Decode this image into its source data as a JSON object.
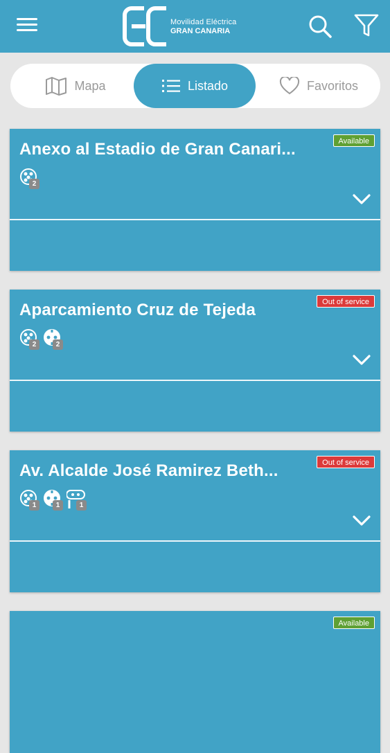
{
  "header": {
    "logo_line1": "Movilidad Eléctrica",
    "logo_line2": "GRAN CANARIA",
    "menu_icon": "hamburger-menu-icon",
    "search_icon": "search-icon",
    "filter_icon": "filter-icon",
    "bg_color": "#41a3c6"
  },
  "tabs": [
    {
      "label": "Mapa",
      "icon": "map-icon",
      "active": false
    },
    {
      "label": "Listado",
      "icon": "list-icon",
      "active": true
    },
    {
      "label": "Favoritos",
      "icon": "heart-icon",
      "active": false
    }
  ],
  "stations": [
    {
      "title": "Anexo al Estadio de Gran Canari...",
      "status": "Available",
      "status_color": "#5fa033",
      "connectors": [
        {
          "type": "type2-connector-icon",
          "count": "2"
        }
      ]
    },
    {
      "title": "Aparcamiento Cruz de Tejeda",
      "status": "Out of service",
      "status_color": "#dc3a3a",
      "connectors": [
        {
          "type": "type2-connector-icon",
          "count": "2"
        },
        {
          "type": "schuko-connector-icon",
          "count": "2"
        }
      ]
    },
    {
      "title": "Av. Alcalde José Ramirez Beth...",
      "status": "Out of service",
      "status_color": "#dc3a3a",
      "connectors": [
        {
          "type": "type2-connector-icon",
          "count": "1"
        },
        {
          "type": "schuko-connector-icon",
          "count": "1"
        },
        {
          "type": "ccs-connector-icon",
          "count": "1"
        }
      ]
    },
    {
      "title": "",
      "status": "Available",
      "status_color": "#5fa033",
      "connectors": []
    }
  ]
}
